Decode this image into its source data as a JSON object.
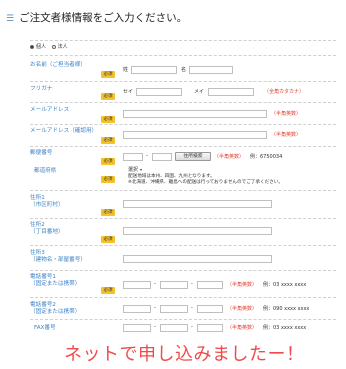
{
  "header": {
    "title": "ご注文者様情報をご入力ください。"
  },
  "customer_type": {
    "options": [
      "個人",
      "法人"
    ],
    "selected": "個人"
  },
  "required_badge": "必須",
  "fields": {
    "name": {
      "label": "お名前（ご担当者様）",
      "sei": "姓",
      "mei": "名"
    },
    "furigana": {
      "label": "フリガナ",
      "sei": "セイ",
      "mei": "メイ",
      "note": "（全角カタカナ）"
    },
    "email": {
      "label": "メールアドレス",
      "note": "（半角英数）"
    },
    "email_confirm": {
      "label": "メールアドレス（確認用）",
      "note": "（半角英数）"
    },
    "postal": {
      "label": "郵便番号",
      "dash": "-",
      "button": "住所検索",
      "note": "（半角英数）",
      "example": "例：6750034"
    },
    "prefecture": {
      "label": "都道府県",
      "select_value": "選択",
      "note_line1": "配送地域は本州、四国、九州となります。",
      "note_line2": "※北海道、沖縄県、離島への配送は行っておりませんのでご了承ください。"
    },
    "address1": {
      "label_line1": "住所1",
      "label_line2": "（市区町村）"
    },
    "address2": {
      "label_line1": "住所2",
      "label_line2": "（丁目番地）"
    },
    "address3": {
      "label_line1": "住所3",
      "label_line2": "（建物名・部屋番号）"
    },
    "phone1": {
      "label_line1": "電話番号1",
      "label_line2": "（固定または携帯）",
      "dash": "-",
      "note": "（半角英数）",
      "example": "例：03 xxxx xxxx"
    },
    "phone2": {
      "label_line1": "電話番号2",
      "label_line2": "（固定または携帯）",
      "dash": "-",
      "note": "（半角英数）",
      "example": "例：090 xxxx xxxx"
    },
    "fax": {
      "label": "FAX番号",
      "dash": "-",
      "note": "（半角英数）",
      "example": "例：03 xxxx xxxx"
    }
  },
  "annotation": "ネットで申し込みましたー！"
}
